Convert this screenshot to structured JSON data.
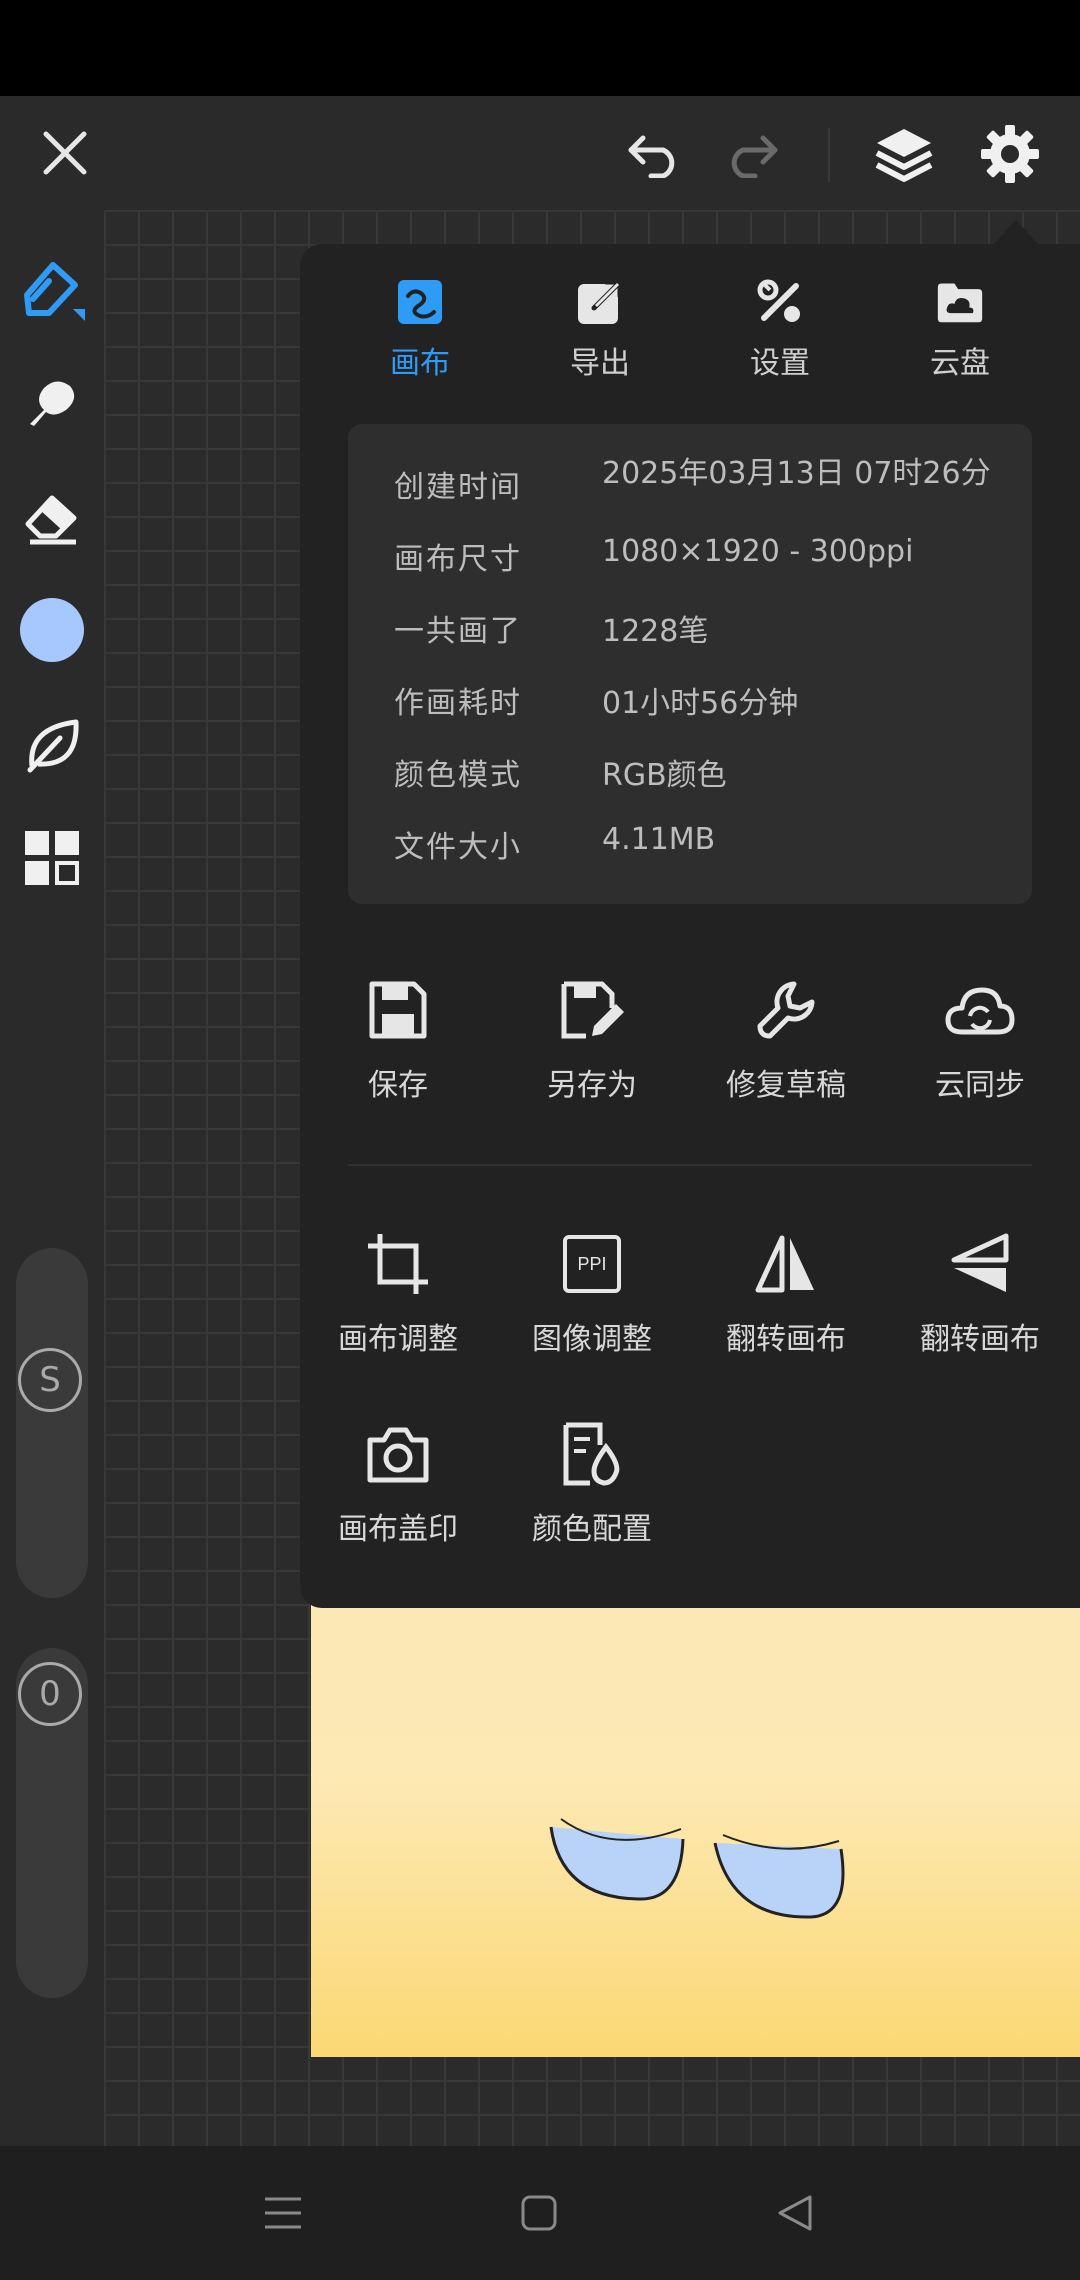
{
  "top_bar": {
    "close_icon": "close-icon",
    "undo_icon": "undo-icon",
    "redo_icon": "redo-icon",
    "layers_icon": "layers-icon",
    "settings_icon": "gear-icon"
  },
  "left_toolbar": {
    "brush_color": "#2e9bf6",
    "current_color": "#a7c8ff",
    "size_knob_label": "S",
    "opacity_knob_label": "0"
  },
  "panel": {
    "tabs": [
      {
        "label": "画布",
        "icon": "canvas-icon",
        "active": true
      },
      {
        "label": "导出",
        "icon": "export-icon",
        "active": false
      },
      {
        "label": "设置",
        "icon": "tools-icon",
        "active": false
      },
      {
        "label": "云盘",
        "icon": "cloud-folder-icon",
        "active": false
      }
    ],
    "info": [
      {
        "key": "创建时间",
        "value": "2025年03月13日 07时26分"
      },
      {
        "key": "画布尺寸",
        "value": "1080×1920 - 300ppi"
      },
      {
        "key": "一共画了",
        "value": "1228笔"
      },
      {
        "key": "作画耗时",
        "value": "01小时56分钟"
      },
      {
        "key": "颜色模式",
        "value": "RGB颜色"
      },
      {
        "key": "文件大小",
        "value": "4.11MB"
      }
    ],
    "actions_row1": [
      {
        "label": "保存",
        "icon": "save-icon"
      },
      {
        "label": "另存为",
        "icon": "save-as-icon"
      },
      {
        "label": "修复草稿",
        "icon": "wrench-icon"
      },
      {
        "label": "云同步",
        "icon": "cloud-sync-icon"
      }
    ],
    "actions_row2": [
      {
        "label": "画布调整",
        "icon": "crop-icon"
      },
      {
        "label": "图像调整",
        "icon": "ppi-icon",
        "icon_text": "PPI"
      },
      {
        "label": "翻转画布",
        "icon": "flip-horizontal-icon"
      },
      {
        "label": "翻转画布",
        "icon": "flip-vertical-icon"
      }
    ],
    "actions_row3": [
      {
        "label": "画布盖印",
        "icon": "camera-icon"
      },
      {
        "label": "颜色配置",
        "icon": "color-profile-icon"
      }
    ]
  },
  "bottom_nav": {
    "menu_icon": "menu-icon",
    "home_icon": "home-icon",
    "back_icon": "back-icon"
  }
}
